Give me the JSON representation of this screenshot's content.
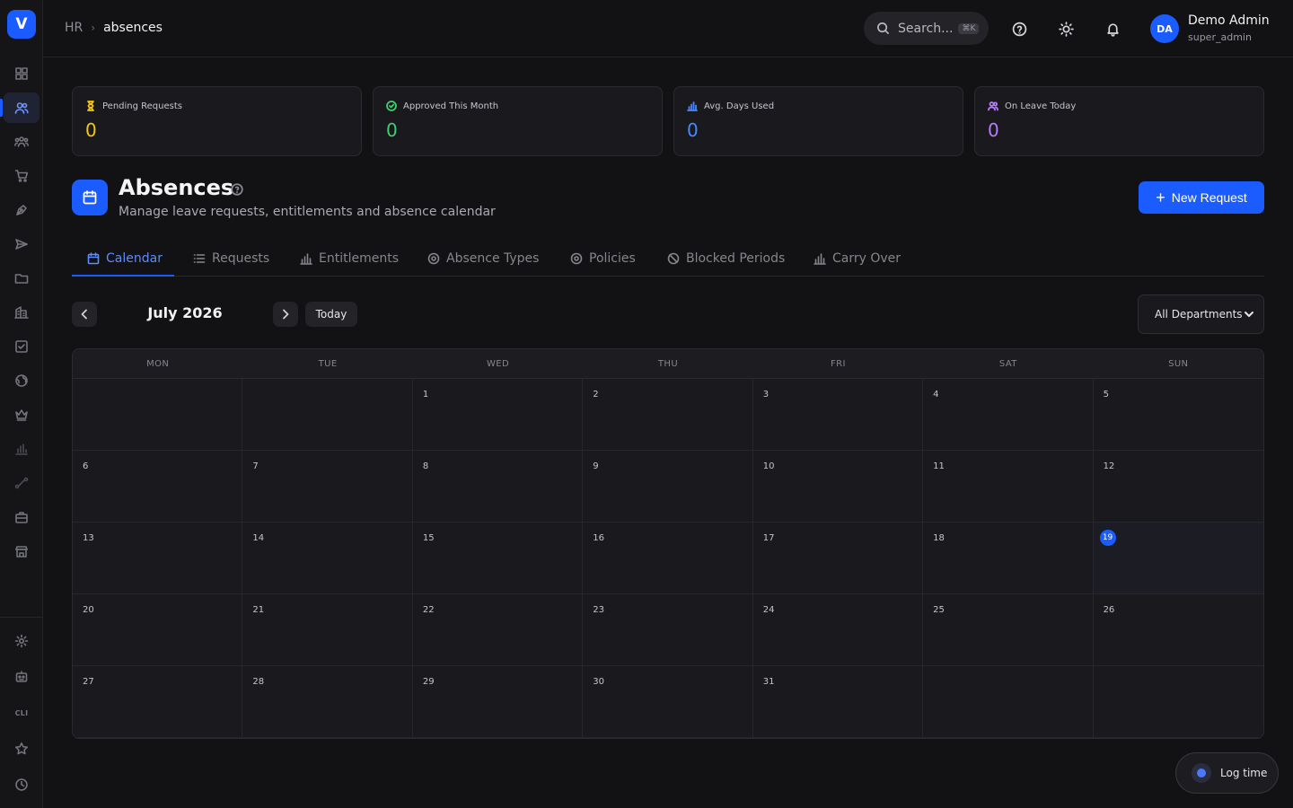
{
  "app": {
    "logo_letter": "V"
  },
  "breadcrumb": {
    "root": "HR",
    "separator": "›",
    "current": "absences"
  },
  "search": {
    "placeholder": "Search...",
    "shortcut": "⌘K"
  },
  "user": {
    "initials": "DA",
    "name": "Demo Admin",
    "role": "super_admin"
  },
  "stats": [
    {
      "label": "Pending Requests",
      "value": "0",
      "color": "#f5c518",
      "icon": "hourglass-icon"
    },
    {
      "label": "Approved This Month",
      "value": "0",
      "color": "#3ecf6e",
      "icon": "check-circle-icon"
    },
    {
      "label": "Avg. Days Used",
      "value": "0",
      "color": "#4a86ff",
      "icon": "bar-chart-icon"
    },
    {
      "label": "On Leave Today",
      "value": "0",
      "color": "#b77bff",
      "icon": "users-icon"
    }
  ],
  "header": {
    "title": "Absences",
    "subtitle": "Manage leave requests, entitlements and absence calendar",
    "new_request_label": "New Request",
    "new_request_plus": "+"
  },
  "tabs": [
    {
      "label": "Calendar",
      "icon": "calendar-icon",
      "active": true
    },
    {
      "label": "Requests",
      "icon": "list-icon"
    },
    {
      "label": "Entitlements",
      "icon": "bar-chart-icon"
    },
    {
      "label": "Absence Types",
      "icon": "gear-icon"
    },
    {
      "label": "Policies",
      "icon": "gear-icon"
    },
    {
      "label": "Blocked Periods",
      "icon": "ban-icon"
    },
    {
      "label": "Carry Over",
      "icon": "bar-chart-icon"
    }
  ],
  "calendar": {
    "month_label": "July 2026",
    "today_label": "Today",
    "department_filter": "All Departments",
    "weekdays": [
      "MON",
      "TUE",
      "WED",
      "THU",
      "FRI",
      "SAT",
      "SUN"
    ],
    "weeks": [
      [
        "",
        "",
        "1",
        "2",
        "3",
        "4",
        "5"
      ],
      [
        "6",
        "7",
        "8",
        "9",
        "10",
        "11",
        "12"
      ],
      [
        "13",
        "14",
        "15",
        "16",
        "17",
        "18",
        "19"
      ],
      [
        "20",
        "21",
        "22",
        "23",
        "24",
        "25",
        "26"
      ],
      [
        "27",
        "28",
        "29",
        "30",
        "31",
        "",
        ""
      ]
    ],
    "today": "19"
  },
  "sidebar": {
    "cli_label": "CLI"
  },
  "log_time": {
    "label": "Log time"
  },
  "colors": {
    "accent": "#1a5cff",
    "background": "#121215"
  }
}
